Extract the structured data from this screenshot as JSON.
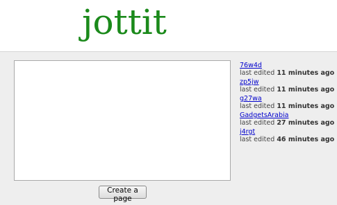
{
  "header": {
    "logo_text": "jottit"
  },
  "editor": {
    "value": ""
  },
  "create_button": {
    "label": "Create a page"
  },
  "recent_pages": [
    {
      "name": "76w4d",
      "prefix": "last edited",
      "time": "11 minutes ago"
    },
    {
      "name": "zp5jw",
      "prefix": "last edited",
      "time": "11 minutes ago"
    },
    {
      "name": "g27wa",
      "prefix": "last edited",
      "time": "11 minutes ago"
    },
    {
      "name": "GadgetsArabia",
      "prefix": "last edited",
      "time": "27 minutes ago"
    },
    {
      "name": "j4rgt",
      "prefix": "last edited",
      "time": "46 minutes ago"
    }
  ],
  "colors": {
    "logo": "#1b8a1b",
    "link": "#0000cc",
    "background": "#eeeeee"
  }
}
